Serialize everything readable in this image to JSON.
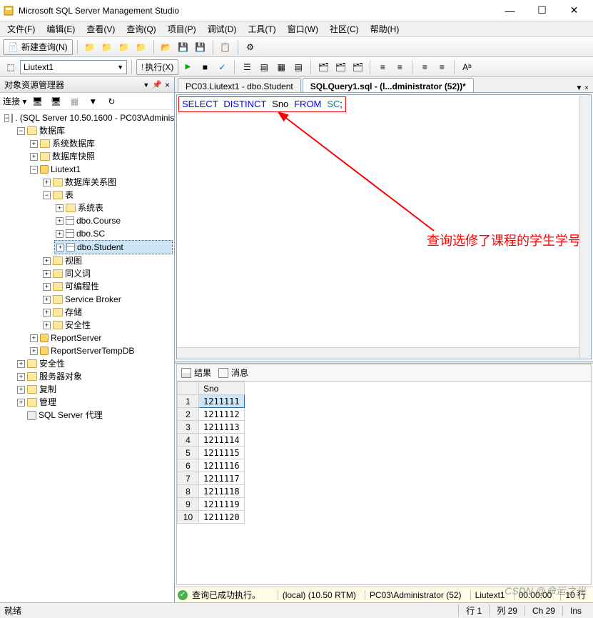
{
  "window": {
    "title": "Microsoft SQL Server Management Studio"
  },
  "menu": {
    "file": "文件(F)",
    "edit": "编辑(E)",
    "view": "查看(V)",
    "query": "查询(Q)",
    "project": "项目(P)",
    "debug": "调试(D)",
    "tools": "工具(T)",
    "window": "窗口(W)",
    "community": "社区(C)",
    "help": "帮助(H)"
  },
  "toolbar": {
    "new_query": "新建查询(N)",
    "db_combo": "Liutext1",
    "execute": "执行(X)"
  },
  "sidebar": {
    "title": "对象资源管理器",
    "connect": "连接 ▾",
    "root": ". (SQL Server 10.50.1600 - PC03\\Administ",
    "databases": "数据库",
    "sysdb": "系统数据库",
    "snapshots": "数据库快照",
    "liutext1": "Liutext1",
    "diagrams": "数据库关系图",
    "tables": "表",
    "systables": "系统表",
    "dbo_course": "dbo.Course",
    "dbo_sc": "dbo.SC",
    "dbo_student": "dbo.Student",
    "views": "视图",
    "synonyms": "同义词",
    "programmability": "可编程性",
    "service_broker": "Service Broker",
    "storage": "存储",
    "security_db": "安全性",
    "reportserver": "ReportServer",
    "reportservertemp": "ReportServerTempDB",
    "security": "安全性",
    "server_objects": "服务器对象",
    "replication": "复制",
    "management": "管理",
    "agent": "SQL Server 代理"
  },
  "tabs": {
    "tab1": "PC03.Liutext1 - dbo.Student",
    "tab2": "SQLQuery1.sql - (l...dministrator (52))*"
  },
  "sql": {
    "select": "SELECT",
    "distinct": "DISTINCT",
    "col": "Sno",
    "from": "FROM",
    "table": "SC",
    "semi": ";"
  },
  "annotation": {
    "text": "查询选修了课程的学生学号"
  },
  "results": {
    "result_tab": "结果",
    "message_tab": "消息",
    "column": "Sno",
    "rows": [
      {
        "n": "1",
        "v": "1211111"
      },
      {
        "n": "2",
        "v": "1211112"
      },
      {
        "n": "3",
        "v": "1211113"
      },
      {
        "n": "4",
        "v": "1211114"
      },
      {
        "n": "5",
        "v": "1211115"
      },
      {
        "n": "6",
        "v": "1211116"
      },
      {
        "n": "7",
        "v": "1211117"
      },
      {
        "n": "8",
        "v": "1211118"
      },
      {
        "n": "9",
        "v": "1211119"
      },
      {
        "n": "10",
        "v": "1211120"
      }
    ]
  },
  "querystatus": {
    "success": "查询已成功执行。",
    "server": "(local) (10.50 RTM)",
    "user": "PC03\\Administrator (52)",
    "db": "Liutext1",
    "time": "00:00:00",
    "rows": "10 行"
  },
  "appstatus": {
    "ready": "就绪",
    "line": "行 1",
    "col": "列 29",
    "ch": "Ch 29",
    "ins": "Ins"
  },
  "watermark": "CSDN @命运之光"
}
